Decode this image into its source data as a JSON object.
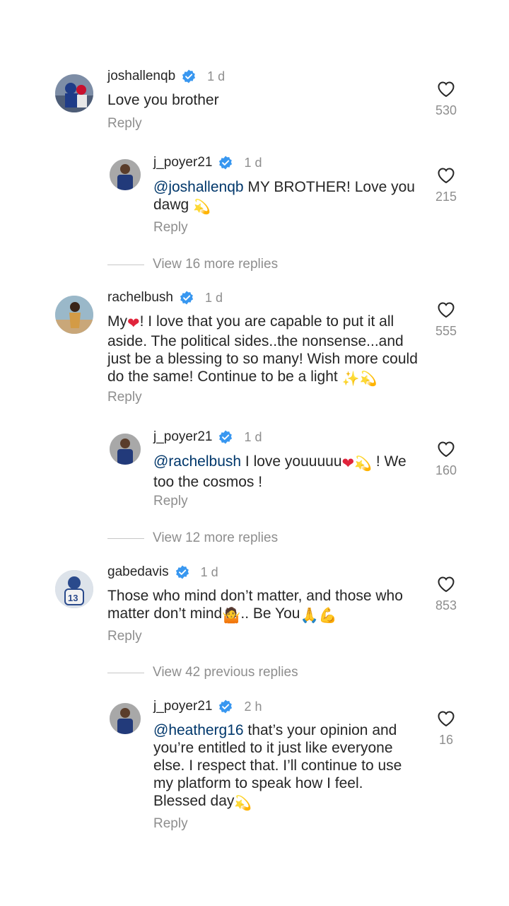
{
  "comments": [
    {
      "username": "joshallenqb",
      "time": "1 d",
      "text": "Love you brother",
      "likes": "530",
      "reply_label": "Reply"
    },
    {
      "username": "j_poyer21",
      "time": "1 d",
      "mention": "@joshallenqb",
      "text": " MY BROTHER! Love you dawg",
      "likes": "215",
      "reply_label": "Reply"
    },
    {
      "view_more": "View 16 more replies"
    },
    {
      "username": "rachelbush",
      "time": "1 d",
      "text_before": "My",
      "text_after": "! I love that you are capable to put it all aside. The political sides..the nonsense...and just be a blessing to so many! Wish more could do the same! Continue to be a light",
      "likes": "555",
      "reply_label": "Reply"
    },
    {
      "username": "j_poyer21",
      "time": "1 d",
      "mention": "@rachelbush",
      "text": " I love youuuuu",
      "text_after": " ! We too the cosmos !",
      "likes": "160",
      "reply_label": "Reply"
    },
    {
      "view_more": "View 12 more replies"
    },
    {
      "username": "gabedavis",
      "time": "1 d",
      "text": "Those who mind don’t matter, and those who matter don’t mind",
      "text_after": ".. Be You",
      "likes": "853",
      "reply_label": "Reply"
    },
    {
      "view_more": "View 42 previous replies"
    },
    {
      "username": "j_poyer21",
      "time": "2 h",
      "mention": "@heatherg16",
      "text": " that’s your opinion and you’re entitled to it just like everyone else. I respect that. I’ll continue to use my platform to speak how I feel. Blessed day",
      "likes": "16",
      "reply_label": "Reply"
    }
  ],
  "colors": {
    "verified": "#3897f0",
    "mention": "#00376b",
    "muted": "#8e8e8e",
    "heart_emoji": "#e0243b"
  },
  "icons": {
    "like": "heart-outline-icon",
    "verified": "verified-badge-icon"
  }
}
